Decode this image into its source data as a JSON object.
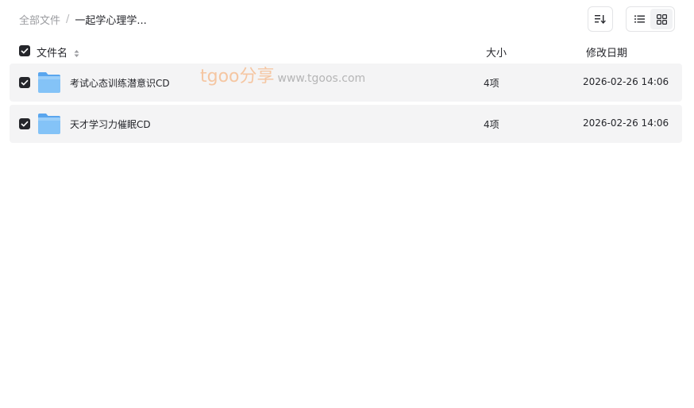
{
  "breadcrumb": {
    "root": "全部文件",
    "separator": "/",
    "current": "一起学心理学..."
  },
  "toolbar": {
    "sort_icon": "sort-icon",
    "list_view_icon": "list-view-icon",
    "grid_view_icon": "grid-view-icon"
  },
  "table": {
    "headers": {
      "name": "文件名",
      "size": "大小",
      "modified": "修改日期"
    },
    "select_all_checked": true,
    "rows": [
      {
        "name": "考试心态训练潜意识CD",
        "size": "4项",
        "modified": "2026-02-26 14:06",
        "checked": true,
        "icon": "folder-icon"
      },
      {
        "name": "天才学习力催眠CD",
        "size": "4项",
        "modified": "2026-02-26 14:06",
        "checked": true,
        "icon": "folder-icon"
      }
    ]
  },
  "watermark": {
    "main": "tgoo分享",
    "sub": "www.tgoos.com"
  },
  "colors": {
    "row_bg": "#f4f4f5",
    "checkbox": "#25262b",
    "folder": "#6ab4f5",
    "watermark": "#f6a05c"
  }
}
